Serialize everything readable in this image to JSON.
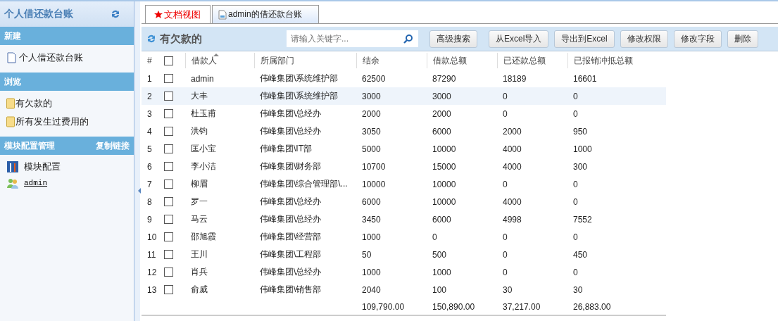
{
  "sidebar": {
    "title": "个人借还款台账",
    "sections": [
      {
        "title": "新建",
        "items": [
          {
            "kind": "doc",
            "label": "个人借还款台账"
          }
        ]
      },
      {
        "title": "浏览",
        "items": [
          {
            "kind": "folder",
            "label": "有欠款的"
          },
          {
            "kind": "folder",
            "label": "所有发生过费用的"
          }
        ]
      },
      {
        "title": "模块配置管理",
        "action": "复制链接",
        "items": [
          {
            "kind": "config",
            "label": "模块配置"
          },
          {
            "kind": "user",
            "label": "admin"
          }
        ]
      }
    ]
  },
  "tabs": [
    {
      "label": "文档视图",
      "kind": "star",
      "selected": false
    },
    {
      "label": "admin的借还款台账",
      "kind": "doc",
      "selected": true
    }
  ],
  "view": {
    "title": "有欠款的",
    "search": {
      "placeholder": "请输入关键字..."
    },
    "buttons": [
      "高级搜索",
      "从Excel导入",
      "导出到Excel",
      "修改权限",
      "修改字段",
      "删除"
    ]
  },
  "table": {
    "columns": [
      {
        "label": "#",
        "sorted": false
      },
      {
        "label": "借款人",
        "sorted": true
      },
      {
        "label": "所属部门",
        "sorted": false
      },
      {
        "label": "结余",
        "sorted": false
      },
      {
        "label": "借款总额",
        "sorted": false
      },
      {
        "label": "已还款总额",
        "sorted": false
      },
      {
        "label": "已报销冲抵总额",
        "sorted": false
      }
    ],
    "all_checked": false,
    "rows": [
      {
        "cells": [
          "1",
          "admin",
          "伟峰集团\\系统维护部",
          "62500",
          "87290",
          "18189",
          "16601"
        ],
        "checked": false,
        "highlighted": false
      },
      {
        "cells": [
          "2",
          "大丰",
          "伟峰集团\\系统维护部",
          "3000",
          "3000",
          "0",
          "0"
        ],
        "checked": false,
        "highlighted": true
      },
      {
        "cells": [
          "3",
          "杜玉甫",
          "伟峰集团\\总经办",
          "2000",
          "2000",
          "0",
          "0"
        ],
        "checked": false,
        "highlighted": false
      },
      {
        "cells": [
          "4",
          "洪钧",
          "伟峰集团\\总经办",
          "3050",
          "6000",
          "2000",
          "950"
        ],
        "checked": false,
        "highlighted": false
      },
      {
        "cells": [
          "5",
          "匡小宝",
          "伟峰集团\\IT部",
          "5000",
          "10000",
          "4000",
          "1000"
        ],
        "checked": false,
        "highlighted": false
      },
      {
        "cells": [
          "6",
          "李小洁",
          "伟峰集团\\财务部",
          "10700",
          "15000",
          "4000",
          "300"
        ],
        "checked": false,
        "highlighted": false
      },
      {
        "cells": [
          "7",
          "柳眉",
          "伟峰集团\\综合管理部\\...",
          "10000",
          "10000",
          "0",
          "0"
        ],
        "checked": false,
        "highlighted": false
      },
      {
        "cells": [
          "8",
          "罗一",
          "伟峰集团\\总经办",
          "6000",
          "10000",
          "4000",
          "0"
        ],
        "checked": false,
        "highlighted": false
      },
      {
        "cells": [
          "9",
          "马云",
          "伟峰集团\\总经办",
          "3450",
          "6000",
          "4998",
          "7552"
        ],
        "checked": false,
        "highlighted": false
      },
      {
        "cells": [
          "10",
          "邵旭霞",
          "伟峰集团\\经营部",
          "1000",
          "0",
          "0",
          "0"
        ],
        "checked": false,
        "highlighted": false
      },
      {
        "cells": [
          "11",
          "王川",
          "伟峰集团\\工程部",
          "50",
          "500",
          "0",
          "450"
        ],
        "checked": false,
        "highlighted": false
      },
      {
        "cells": [
          "12",
          "肖兵",
          "伟峰集团\\总经办",
          "1000",
          "1000",
          "0",
          "0"
        ],
        "checked": false,
        "highlighted": false
      },
      {
        "cells": [
          "13",
          "俞威",
          "伟峰集团\\销售部",
          "2040",
          "100",
          "30",
          "30"
        ],
        "checked": false,
        "highlighted": false
      }
    ],
    "totals": [
      "109,790.00",
      "150,890.00",
      "37,217.00",
      "26,883.00"
    ]
  }
}
